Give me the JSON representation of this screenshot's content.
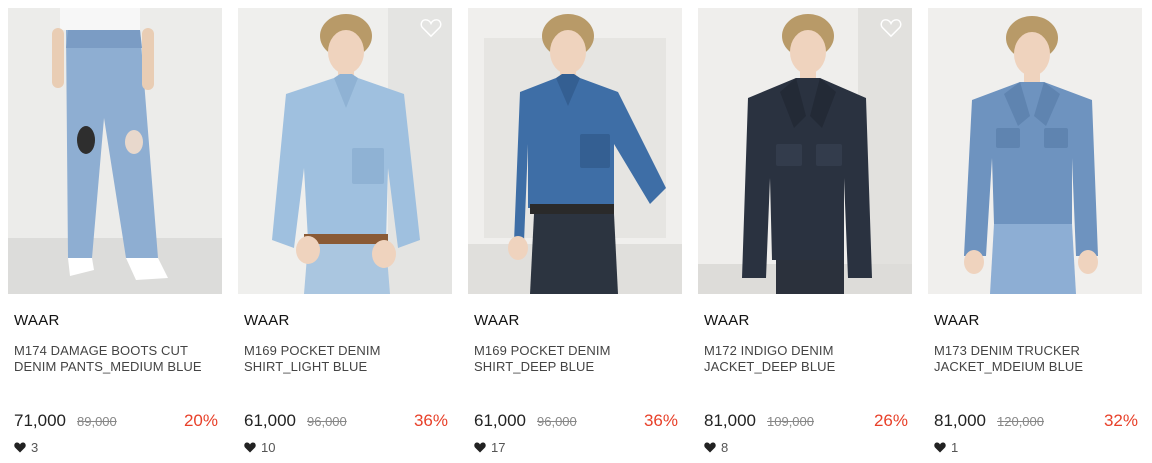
{
  "products": [
    {
      "brand": "WAAR",
      "name_line1": "M174 DAMAGE BOOTS CUT",
      "name_line2": "DENIM PANTS_MEDIUM BLUE",
      "price": "71,000",
      "original_price": "89,000",
      "discount": "20%",
      "likes": "3"
    },
    {
      "brand": "WAAR",
      "name_line1": "M169 POCKET DENIM",
      "name_line2": "SHIRT_LIGHT BLUE",
      "price": "61,000",
      "original_price": "96,000",
      "discount": "36%",
      "likes": "10"
    },
    {
      "brand": "WAAR",
      "name_line1": "M169 POCKET DENIM",
      "name_line2": "SHIRT_DEEP BLUE",
      "price": "61,000",
      "original_price": "96,000",
      "discount": "36%",
      "likes": "17"
    },
    {
      "brand": "WAAR",
      "name_line1": "M172 INDIGO DENIM",
      "name_line2": "JACKET_DEEP BLUE",
      "price": "81,000",
      "original_price": "109,000",
      "discount": "26%",
      "likes": "8"
    },
    {
      "brand": "WAAR",
      "name_line1": "M173 DENIM TRUCKER",
      "name_line2": "JACKET_MDEIUM BLUE",
      "price": "81,000",
      "original_price": "120,000",
      "discount": "32%",
      "likes": "1"
    }
  ],
  "icons": {
    "wishlist": "heart-outline-icon",
    "likes": "heart-filled-icon"
  },
  "colors": {
    "discount": "#e8412a",
    "text": "#222222"
  }
}
